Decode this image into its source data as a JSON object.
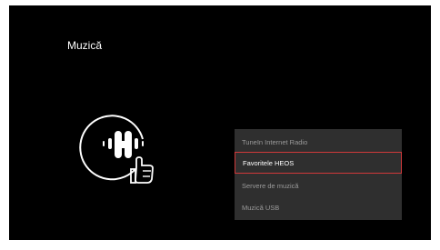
{
  "screen": {
    "title": "Muzică"
  },
  "logo": {
    "icon": "heos-hand-pointer-icon"
  },
  "menu": {
    "items": [
      {
        "label": "TuneIn Internet Radio",
        "selected": false
      },
      {
        "label": "Favoritele HEOS",
        "selected": true
      },
      {
        "label": "Servere de muzică",
        "selected": false
      },
      {
        "label": "Muzică USB",
        "selected": false
      }
    ]
  },
  "colors": {
    "background": "#000000",
    "menu_bg": "#2f2f2f",
    "selection_border": "#d0393a",
    "text_selected": "#ffffff",
    "text_normal": "#9a9a9a"
  }
}
